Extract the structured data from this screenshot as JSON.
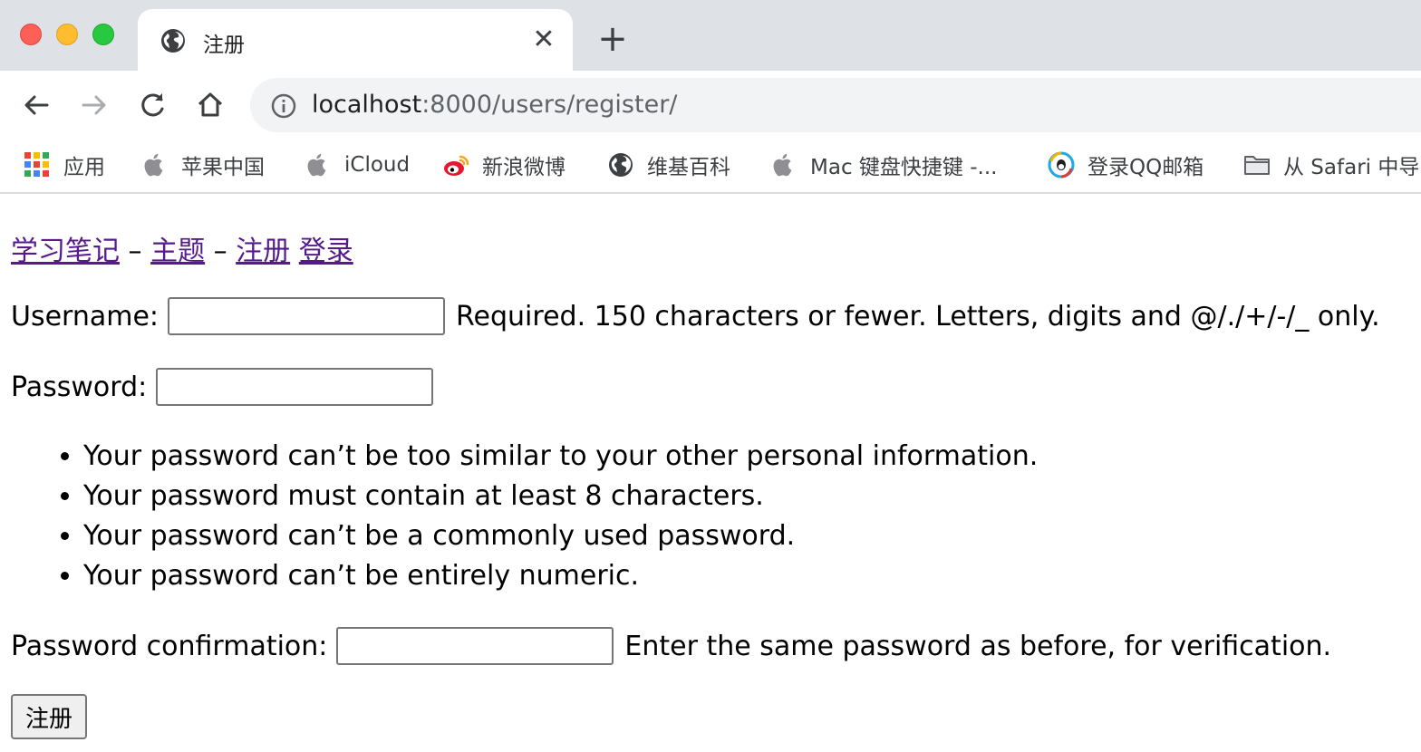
{
  "browser": {
    "tab_title": "注册",
    "tab_close_glyph": "✕",
    "new_tab_glyph": "+",
    "url_host": "localhost",
    "url_path": ":8000/users/register/",
    "bookmarks": [
      {
        "label": "应用",
        "icon": "apps-grid-icon"
      },
      {
        "label": "苹果中国",
        "icon": "apple-icon"
      },
      {
        "label": "iCloud",
        "icon": "apple-icon"
      },
      {
        "label": "新浪微博",
        "icon": "weibo-icon"
      },
      {
        "label": "维基百科",
        "icon": "globe-icon"
      },
      {
        "label": "Mac 键盘快捷键 -...",
        "icon": "apple-icon"
      },
      {
        "label": "登录QQ邮箱",
        "icon": "qq-mail-icon"
      },
      {
        "label": "从 Safari 中导",
        "icon": "folder-icon"
      }
    ]
  },
  "nav": {
    "home": "学习笔记",
    "sep1": "–",
    "topics": "主题",
    "sep2": "–",
    "register": "注册",
    "login": "登录"
  },
  "form": {
    "username_label": "Username:",
    "username_value": "",
    "username_help": "Required. 150 characters or fewer. Letters, digits and @/./+/-/_ only.",
    "password_label": "Password:",
    "password_value": "",
    "password_rules": [
      "Your password can’t be too similar to your other personal information.",
      "Your password must contain at least 8 characters.",
      "Your password can’t be a commonly used password.",
      "Your password can’t be entirely numeric."
    ],
    "confirm_label": "Password confirmation:",
    "confirm_value": "",
    "confirm_help": "Enter the same password as before, for verification.",
    "submit_label": "注册"
  },
  "colors": {
    "visited_link": "#551a8b",
    "tabstrip_bg": "#dee1e6",
    "omnibox_bg": "#f1f3f4"
  }
}
